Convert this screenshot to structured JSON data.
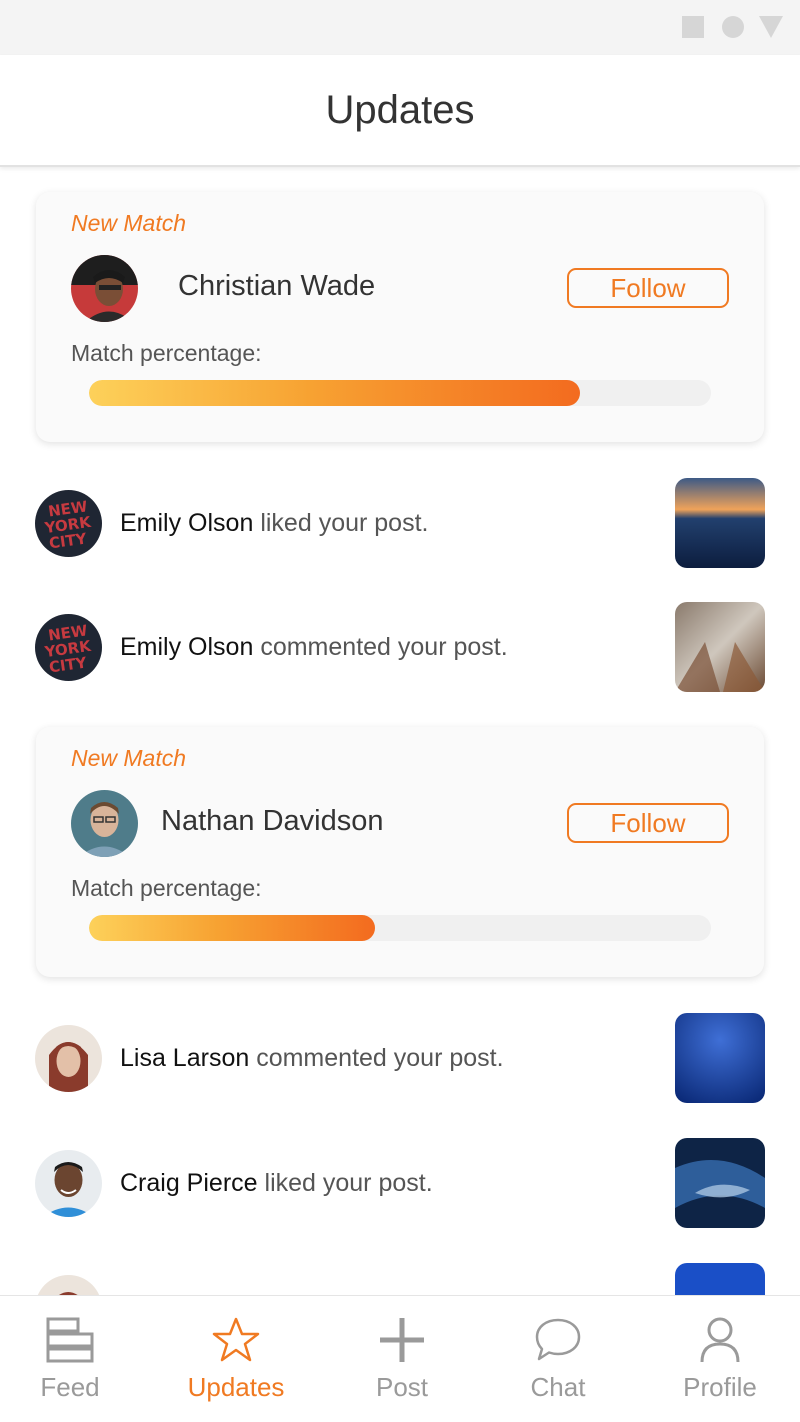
{
  "header": {
    "title": "Updates"
  },
  "matches": [
    {
      "tag": "New Match",
      "name": "Christian Wade",
      "follow_label": "Follow",
      "match_label": "Match percentage:",
      "match_percent": 79
    },
    {
      "tag": "New Match",
      "name": "Nathan Davidson",
      "follow_label": "Follow",
      "match_label": "Match percentage:",
      "match_percent": 46
    }
  ],
  "activities": [
    {
      "name": "Emily Olson",
      "action": "liked your post."
    },
    {
      "name": "Emily Olson",
      "action": "commented your post."
    },
    {
      "name": "Lisa Larson",
      "action": "commented your post."
    },
    {
      "name": "Craig Pierce",
      "action": "liked your post."
    }
  ],
  "tabs": [
    {
      "label": "Feed",
      "icon": "feed-icon"
    },
    {
      "label": "Updates",
      "icon": "star-icon"
    },
    {
      "label": "Post",
      "icon": "plus-icon"
    },
    {
      "label": "Chat",
      "icon": "chat-bubble-icon"
    },
    {
      "label": "Profile",
      "icon": "person-icon"
    }
  ],
  "colors": {
    "accent": "#f07a22",
    "inactive": "#9a9a9a"
  }
}
